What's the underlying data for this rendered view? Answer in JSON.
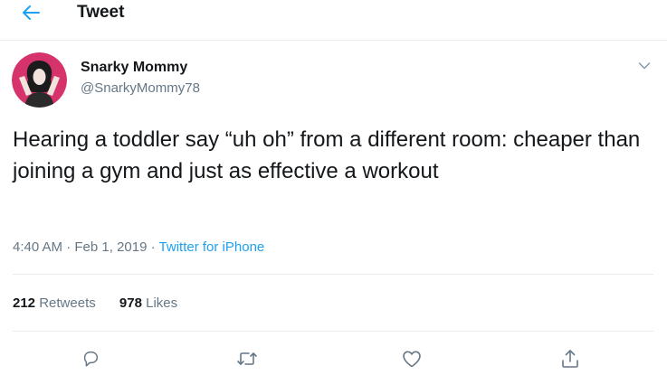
{
  "header": {
    "title": "Tweet",
    "back_icon": "arrow-left-icon"
  },
  "author": {
    "name": "Snarky Mommy",
    "handle": "@SnarkyMommy78",
    "menu_icon": "chevron-down-icon"
  },
  "tweet": {
    "text": "Hearing a toddler say “uh oh” from a different room: cheaper than joining a gym and just as effective a workout",
    "time": "4:40 AM",
    "date": "Feb 1, 2019",
    "source": "Twitter for iPhone",
    "separator": "·"
  },
  "stats": {
    "retweets_count": "212",
    "retweets_label": "Retweets",
    "likes_count": "978",
    "likes_label": "Likes"
  },
  "actions": [
    "reply-icon",
    "retweet-icon",
    "like-icon",
    "share-icon"
  ],
  "colors": {
    "accent": "#1da1f2",
    "text": "#14171a",
    "secondary": "#657786",
    "border": "#e6ecf0",
    "avatar_bg": "#d6336c"
  }
}
